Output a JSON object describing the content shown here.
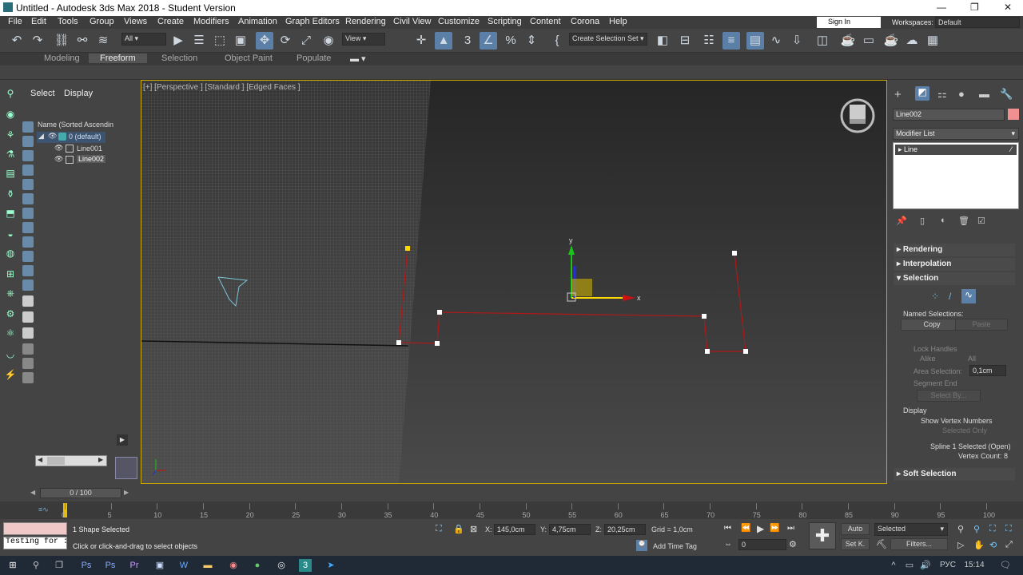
{
  "window": {
    "title": "Untitled - Autodesk 3ds Max 2018 - Student Version",
    "minimize": "—",
    "maximize": "❐",
    "close": "✕"
  },
  "menu": [
    "File",
    "Edit",
    "Tools",
    "Group",
    "Views",
    "Create",
    "Modifiers",
    "Animation",
    "Graph Editors",
    "Rendering",
    "Civil View",
    "Customize",
    "Scripting",
    "Content",
    "Corona",
    "Help"
  ],
  "account": {
    "signin": "Sign In",
    "workspaces_label": "Workspaces:",
    "workspace": "Default"
  },
  "toolbar": {
    "filter": "All",
    "view": "View",
    "selection_set": "Create Selection Set"
  },
  "ribbon": {
    "tabs": [
      "Modeling",
      "Freeform",
      "Selection",
      "Object Paint",
      "Populate"
    ],
    "active": "Freeform"
  },
  "scene_explorer": {
    "tabs": [
      "Select",
      "Display"
    ],
    "header": "Name (Sorted Ascendin",
    "items": [
      {
        "label": "0 (default)"
      },
      {
        "label": "Line001"
      },
      {
        "label": "Line002"
      }
    ]
  },
  "viewport": {
    "label": "[+] [Perspective ] [Standard ] [Edged Faces ]",
    "axis_x": "x",
    "axis_y": "y"
  },
  "command_panel": {
    "object_name": "Line002",
    "object_color": "#f09090",
    "modifier_list": "Modifier List",
    "stack_item": "Line",
    "rollouts": {
      "rendering": "Rendering",
      "interpolation": "Interpolation",
      "selection": "Selection",
      "soft": "Soft Selection"
    },
    "named_selections": "Named Selections:",
    "copy": "Copy",
    "paste": "Paste",
    "lock_handles": "Lock Handles",
    "alike": "Alike",
    "all": "All",
    "area_selection": "Area Selection:",
    "area_value": "0,1cm",
    "segment_end": "Segment End",
    "select_by": "Select By...",
    "display": "Display",
    "show_vertex_numbers": "Show Vertex Numbers",
    "selected_only": "Selected Only",
    "spline_status": "Spline 1 Selected (Open)",
    "vertex_count": "Vertex Count: 8"
  },
  "timeline": {
    "frame": "0 / 100",
    "ticks": [
      "0",
      "5",
      "10",
      "15",
      "20",
      "25",
      "30",
      "35",
      "40",
      "45",
      "50",
      "55",
      "60",
      "65",
      "70",
      "75",
      "80",
      "85",
      "90",
      "95",
      "100"
    ]
  },
  "status": {
    "script": "Testing for :",
    "selected": "1 Shape Selected",
    "prompt": "Click or click-and-drag to select objects",
    "x_label": "X:",
    "x": "145,0cm",
    "y_label": "Y:",
    "y": "4,75cm",
    "z_label": "Z:",
    "z": "20,25cm",
    "grid": "Grid = 1,0cm",
    "add_time_tag": "Add Time Tag",
    "auto": "Auto",
    "setk": "Set K.",
    "selected_dropdown": "Selected",
    "filters": "Filters...",
    "frame_field": "0"
  },
  "taskbar": {
    "lang": "РУС",
    "time": "15:14"
  }
}
